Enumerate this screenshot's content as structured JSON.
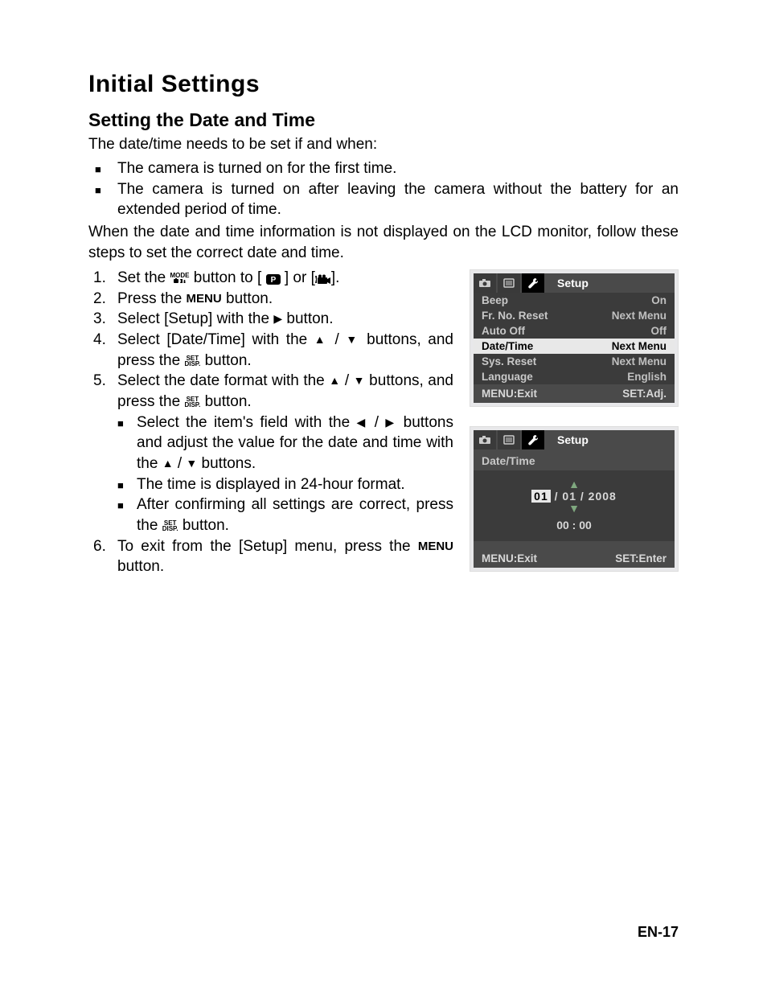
{
  "page_number": "EN-17",
  "h1": "Initial Settings",
  "h2": "Setting the Date and Time",
  "intro": "The date/time needs to be set if and when:",
  "bullets": {
    "b1": "The camera is turned on for the first time.",
    "b2": "The camera is turned on after leaving the camera without the battery for an extended period of time."
  },
  "para": "When the date and time information is not displayed on the LCD monitor, follow these steps to set the correct date and time.",
  "steps": {
    "s1a": "Set the ",
    "s1b": " button to [ ",
    "s1c": " ] or [",
    "s1d": "].",
    "s2a": "Press the ",
    "s2b": " button.",
    "s3a": "Select [Setup] with the ",
    "s3b": " button.",
    "s4a": "Select [Date/Time] with the ",
    "s4b": " buttons, and press the ",
    "s4c": " button.",
    "s5a": "Select the date format with the ",
    "s5b": " buttons, and press the ",
    "s5c": " button.",
    "s5_sub1a": "Select the item's field with the ",
    "s5_sub1b": " buttons and adjust the value for the date and time with the ",
    "s5_sub1c": " buttons.",
    "s5_sub2": "The time is displayed in 24-hour format.",
    "s5_sub3a": "After confirming all settings are correct, press the ",
    "s5_sub3b": " button.",
    "s6a": "To exit from the [Setup] menu, press the ",
    "s6b": " button."
  },
  "labels": {
    "mode_top": "MODE",
    "set_top": "SET",
    "set_bot": "DISP.",
    "menu": "MENU",
    "tri_right": "▶",
    "tri_left": "◀",
    "tri_up": "▲",
    "tri_down": "▼",
    "slash": " / "
  },
  "lcd1": {
    "title": "Setup",
    "rows": [
      {
        "k": "Beep",
        "v": "On"
      },
      {
        "k": "Fr. No. Reset",
        "v": "Next Menu"
      },
      {
        "k": "Auto Off",
        "v": "Off"
      },
      {
        "k": "Date/Time",
        "v": "Next Menu"
      },
      {
        "k": "Sys. Reset",
        "v": "Next Menu"
      },
      {
        "k": "Language",
        "v": "English"
      }
    ],
    "foot_l": "MENU:Exit",
    "foot_r": "SET:Adj."
  },
  "lcd2": {
    "title": "Setup",
    "subtitle": "Date/Time",
    "date_sel": "01",
    "date_rest": "  /  01  /  2008",
    "time": "00  :  00",
    "foot_l": "MENU:Exit",
    "foot_r": "SET:Enter"
  }
}
